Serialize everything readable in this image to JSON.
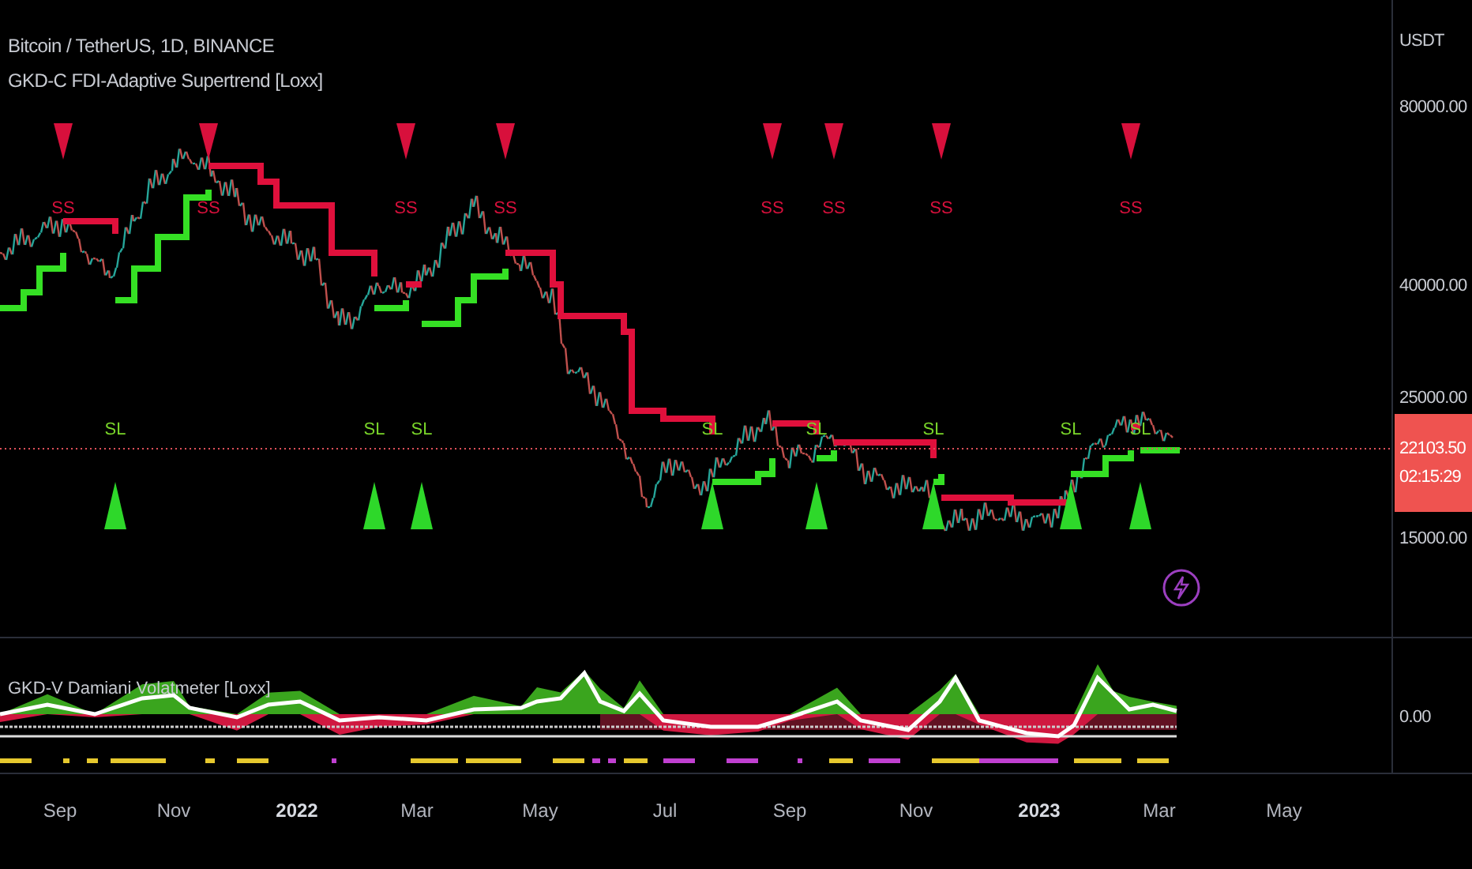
{
  "header": {
    "symbol": "Bitcoin / TetherUS, 1D, BINANCE",
    "indicator": "GKD-C FDI-Adaptive Supertrend [Loxx]"
  },
  "signals": [
    {
      "kind": "ss",
      "label": "SS"
    },
    {
      "kind": "ss",
      "label": "SS"
    },
    {
      "kind": "ss",
      "label": "SS"
    },
    {
      "kind": "ss",
      "label": "SS"
    },
    {
      "kind": "ss",
      "label": "SS"
    },
    {
      "kind": "ss",
      "label": "SS"
    },
    {
      "kind": "ss",
      "label": "SS"
    },
    {
      "kind": "ss",
      "label": "SS"
    },
    {
      "kind": "sl",
      "label": "SL"
    },
    {
      "kind": "sl",
      "label": "SL"
    },
    {
      "kind": "sl",
      "label": "SL"
    },
    {
      "kind": "sl",
      "label": "SL"
    },
    {
      "kind": "sl",
      "label": "SL"
    },
    {
      "kind": "sl",
      "label": "SL"
    },
    {
      "kind": "sl",
      "label": "SL"
    },
    {
      "kind": "sl",
      "label": "SL"
    }
  ],
  "price_axis": {
    "currency": "USDT",
    "ticks": [
      "80000.00",
      "40000.00",
      "25000.00",
      "15000.00"
    ],
    "last_price": "22103.50",
    "countdown": "02:15:29"
  },
  "indicator_pane": {
    "title": "GKD-V Damiani Volatmeter [Loxx]",
    "tick": "0.00"
  },
  "time_axis": [
    {
      "label": "Sep",
      "kind": "month"
    },
    {
      "label": "Nov",
      "kind": "month"
    },
    {
      "label": "2022",
      "kind": "year"
    },
    {
      "label": "Mar",
      "kind": "month"
    },
    {
      "label": "May",
      "kind": "month"
    },
    {
      "label": "Jul",
      "kind": "month"
    },
    {
      "label": "Sep",
      "kind": "month"
    },
    {
      "label": "Nov",
      "kind": "month"
    },
    {
      "label": "2023",
      "kind": "year"
    },
    {
      "label": "Mar",
      "kind": "month"
    },
    {
      "label": "May",
      "kind": "month"
    }
  ]
}
